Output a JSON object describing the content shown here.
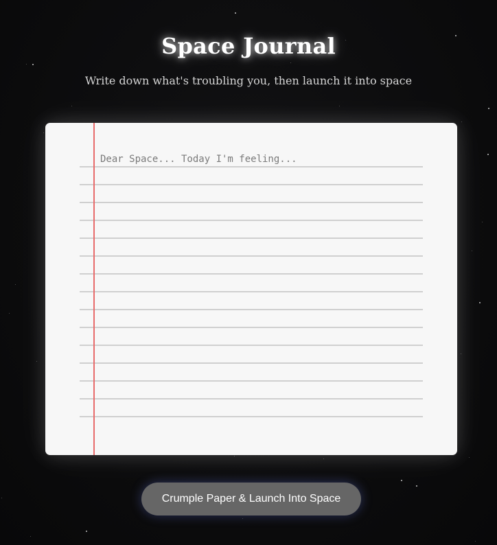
{
  "app": {
    "title": "Space Journal",
    "subtitle": "Write down what's troubling you, then launch it into space"
  },
  "journal": {
    "value": "",
    "placeholder": "Dear Space... Today I'm feeling...",
    "line_count": 15,
    "colors": {
      "paper": "#f7f7f7",
      "margin_line": "#e86a6a",
      "rule_line": "#cfcfcf"
    }
  },
  "launch_button": {
    "label": "Crumple Paper & Launch Into Space",
    "color": "#666666"
  },
  "background": {
    "color": "#0c0c0d",
    "star_color": "#ffffff"
  }
}
